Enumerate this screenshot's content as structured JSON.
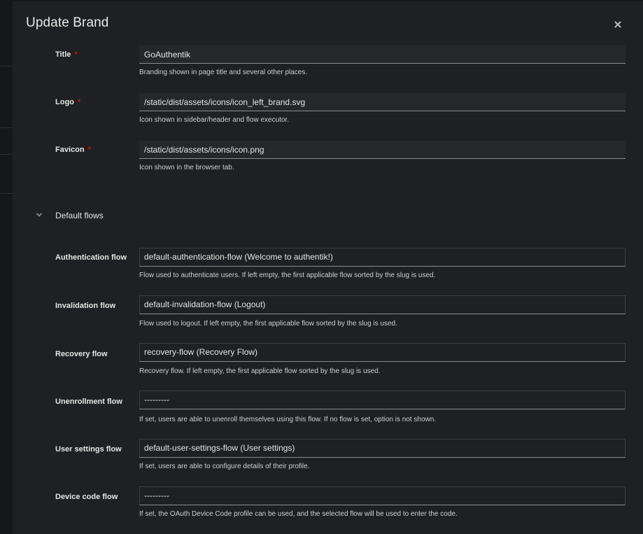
{
  "modal": {
    "title": "Update Brand",
    "close_icon": "close-icon"
  },
  "fields": {
    "title": {
      "label": "Title",
      "required_mark": "*",
      "value": "GoAuthentik",
      "helper": "Branding shown in page title and several other places."
    },
    "logo": {
      "label": "Logo",
      "required_mark": "*",
      "value": "/static/dist/assets/icons/icon_left_brand.svg",
      "helper": "Icon shown in sidebar/header and flow executor."
    },
    "favicon": {
      "label": "Favicon",
      "required_mark": "*",
      "value": "/static/dist/assets/icons/icon.png",
      "helper": "Icon shown in the browser tab."
    }
  },
  "default_flows": {
    "section_title": "Default flows",
    "toggle_icon": "chevron-down-icon",
    "authentication": {
      "label": "Authentication flow",
      "value": "default-authentication-flow (Welcome to authentik!)",
      "helper": "Flow used to authenticate users. If left empty, the first applicable flow sorted by the slug is used."
    },
    "invalidation": {
      "label": "Invalidation flow",
      "value": "default-invalidation-flow (Logout)",
      "helper": "Flow used to logout. If left empty, the first applicable flow sorted by the slug is used."
    },
    "recovery": {
      "label": "Recovery flow",
      "value": "recovery-flow (Recovery Flow)",
      "helper": "Recovery flow. If left empty, the first applicable flow sorted by the slug is used."
    },
    "unenrollment": {
      "label": "Unenrollment flow",
      "value": "---------",
      "helper": "If set, users are able to unenroll themselves using this flow. If no flow is set, option is not shown."
    },
    "user_settings": {
      "label": "User settings flow",
      "value": "default-user-settings-flow (User settings)",
      "helper": "If set, users are able to configure details of their profile."
    },
    "device_code": {
      "label": "Device code flow",
      "value": "---------",
      "helper": "If set, the OAuth Device Code profile can be used, and the selected flow will be used to enter the code."
    }
  }
}
